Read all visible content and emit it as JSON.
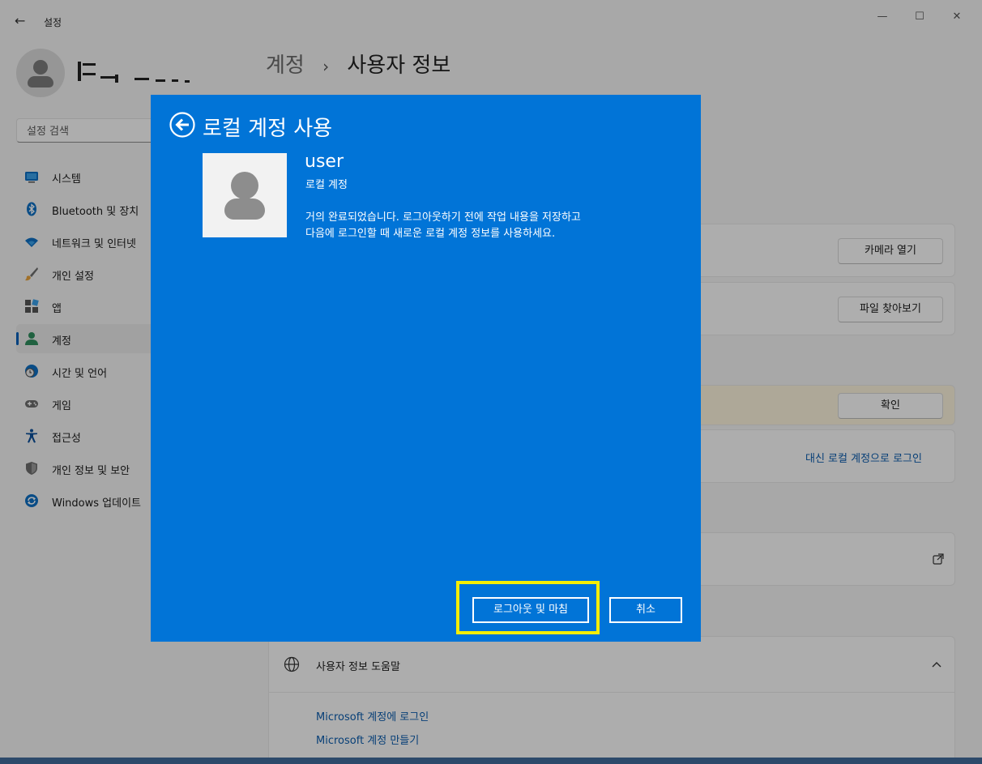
{
  "window": {
    "app_title": "설정",
    "back_glyph": "←",
    "minimize_glyph": "—",
    "maximize_glyph": "☐",
    "close_glyph": "✕"
  },
  "sidebar": {
    "search_placeholder": "설정 검색",
    "items": [
      {
        "label": "시스템",
        "icon": "monitor-icon",
        "active": false
      },
      {
        "label": "Bluetooth 및 장치",
        "icon": "bluetooth-icon",
        "active": false
      },
      {
        "label": "네트워크 및 인터넷",
        "icon": "wifi-icon",
        "active": false
      },
      {
        "label": "개인 설정",
        "icon": "paintbrush-icon",
        "active": false
      },
      {
        "label": "앱",
        "icon": "apps-icon",
        "active": false
      },
      {
        "label": "계정",
        "icon": "person-icon",
        "active": true
      },
      {
        "label": "시간 및 언어",
        "icon": "globe-clock-icon",
        "active": false
      },
      {
        "label": "게임",
        "icon": "gamepad-icon",
        "active": false
      },
      {
        "label": "접근성",
        "icon": "accessibility-icon",
        "active": false
      },
      {
        "label": "개인 정보 및 보안",
        "icon": "shield-icon",
        "active": false
      },
      {
        "label": "Windows 업데이트",
        "icon": "update-icon",
        "active": false
      }
    ]
  },
  "main": {
    "breadcrumb_parent": "계정",
    "breadcrumb_sep": "›",
    "breadcrumb_current": "사용자 정보",
    "camera_button": "카메라 열기",
    "browse_button": "파일 찾아보기",
    "confirm_button": "확인",
    "local_login_link": "대신 로컬 계정으로 로그인",
    "help_title": "사용자 정보 도움말",
    "help_links": [
      "Microsoft 계정에 로그인",
      "Microsoft 계정 만들기"
    ]
  },
  "dialog": {
    "title": "로컬 계정 사용",
    "username": "user",
    "account_type": "로컬 계정",
    "message_line1": "거의 완료되었습니다. 로그아웃하기 전에 작업 내용을 저장하고",
    "message_line2": "다음에 로그인할 때 새로운 로컬 계정 정보를 사용하세요.",
    "primary_button": "로그아웃 및 마침",
    "cancel_button": "취소"
  },
  "colors": {
    "dialog_bg": "#0174d7",
    "highlight": "#f5ee00",
    "accent": "#005fb8",
    "link": "#0b5cad"
  }
}
